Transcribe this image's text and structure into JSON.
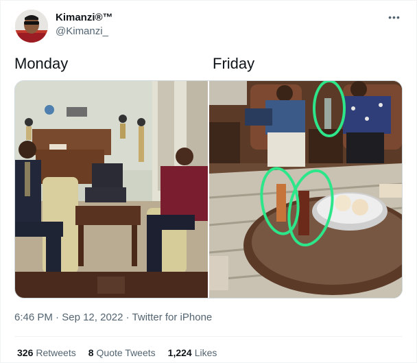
{
  "author": {
    "display_name": "Kimanzi®™",
    "handle": "@Kimanzi_"
  },
  "icons": {
    "more": "more-horizontal-icon"
  },
  "captions": {
    "left": "Monday",
    "right": "Friday"
  },
  "meta": {
    "time": "6:46 PM",
    "dot": " · ",
    "date": "Sep 12, 2022",
    "dot2": " · ",
    "source": "Twitter for iPhone"
  },
  "stats": [
    {
      "count": "326",
      "label": "Retweets"
    },
    {
      "count": "8",
      "label": "Quote Tweets"
    },
    {
      "count": "1,224",
      "label": "Likes"
    }
  ],
  "colors": {
    "text_primary": "#0f1419",
    "text_secondary": "#536471",
    "highlight_circles": "#2ee68a"
  }
}
